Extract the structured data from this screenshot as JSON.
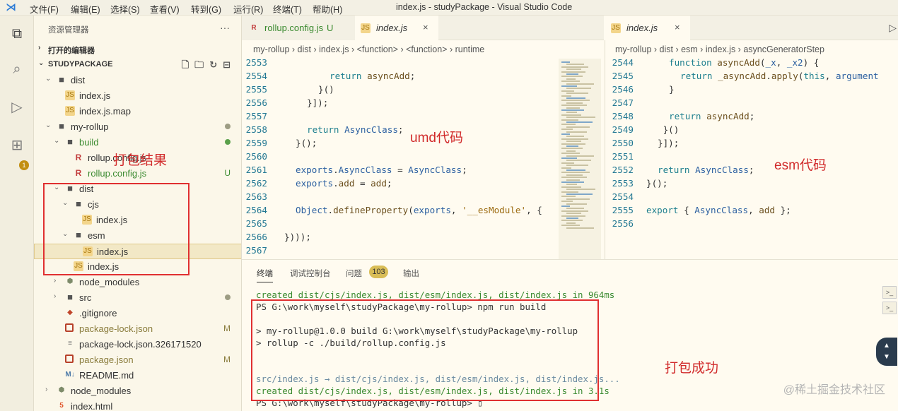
{
  "window": {
    "title": "index.js - studyPackage - Visual Studio Code",
    "menu": [
      "文件(F)",
      "编辑(E)",
      "选择(S)",
      "查看(V)",
      "转到(G)",
      "运行(R)",
      "终端(T)",
      "帮助(H)"
    ]
  },
  "activity_bar": {
    "icons": [
      "explorer-icon",
      "search-icon",
      "run-debug-icon",
      "extensions-icon"
    ],
    "badge": "1"
  },
  "sidebar": {
    "title": "资源管理器",
    "more": "···",
    "open_editors": "打开的编辑器",
    "workspace": "STUDYPACKAGE",
    "tree": [
      {
        "name": "dist",
        "type": "folder",
        "indent": 1
      },
      {
        "name": "index.js",
        "type": "js",
        "indent": 2
      },
      {
        "name": "index.js.map",
        "type": "js",
        "indent": 2
      },
      {
        "name": "my-rollup",
        "type": "folder",
        "indent": 1,
        "status": "dot"
      },
      {
        "name": "build",
        "type": "folder",
        "indent": 2,
        "status": "dot-green",
        "color": "green"
      },
      {
        "name": "rollup.config.js",
        "type": "rollup",
        "indent": 3
      },
      {
        "name": "rollup.config.js",
        "type": "rollup",
        "indent": 3,
        "status": "U",
        "color": "green"
      },
      {
        "name": "dist",
        "type": "folder",
        "indent": 2
      },
      {
        "name": "cjs",
        "type": "folder",
        "indent": 3
      },
      {
        "name": "index.js",
        "type": "js",
        "indent": 4
      },
      {
        "name": "esm",
        "type": "folder",
        "indent": 3
      },
      {
        "name": "index.js",
        "type": "js",
        "indent": 4,
        "selected": true
      },
      {
        "name": "index.js",
        "type": "js",
        "indent": 3
      },
      {
        "name": "node_modules",
        "type": "nm",
        "indent": 2
      },
      {
        "name": "src",
        "type": "folder",
        "indent": 2,
        "status": "dot"
      },
      {
        "name": ".gitignore",
        "type": "git",
        "indent": 2
      },
      {
        "name": "package-lock.json",
        "type": "json",
        "indent": 2,
        "status": "M",
        "color": "olive"
      },
      {
        "name": "package-lock.json.326171520",
        "type": "file",
        "indent": 2
      },
      {
        "name": "package.json",
        "type": "json",
        "indent": 2,
        "status": "M",
        "color": "olive"
      },
      {
        "name": "README.md",
        "type": "md",
        "indent": 2
      },
      {
        "name": "node_modules",
        "type": "nm",
        "indent": 1
      },
      {
        "name": "index.html",
        "type": "html",
        "indent": 1
      }
    ]
  },
  "editor_left": {
    "tabs": [
      {
        "label": "rollup.config.js",
        "status": "U",
        "icon": "rollup"
      },
      {
        "label": "index.js",
        "close": "×",
        "icon": "js"
      }
    ],
    "breadcrumb": [
      "my-rollup",
      "dist",
      "index.js",
      "<function>",
      "<function>",
      "runtime"
    ],
    "lines": [
      {
        "n": "2553",
        "indent": 3,
        "parts": [
          [
            "",
            ""
          ]
        ]
      },
      {
        "n": "2554",
        "indent": 4,
        "parts": [
          [
            "kw",
            "return "
          ],
          [
            "fn",
            "asyncAdd"
          ],
          [
            "tx-d",
            ";"
          ]
        ]
      },
      {
        "n": "2555",
        "indent": 3,
        "parts": [
          [
            "tx-d",
            "}()"
          ]
        ]
      },
      {
        "n": "2556",
        "indent": 2,
        "parts": [
          [
            "tx-d",
            "}]);"
          ]
        ]
      },
      {
        "n": "2557",
        "indent": 0,
        "parts": [
          [
            "",
            ""
          ]
        ]
      },
      {
        "n": "2558",
        "indent": 2,
        "parts": [
          [
            "kw",
            "return "
          ],
          [
            "id",
            "AsyncClass"
          ],
          [
            "tx-d",
            ";"
          ]
        ]
      },
      {
        "n": "2559",
        "indent": 1,
        "parts": [
          [
            "tx-d",
            "}();"
          ]
        ]
      },
      {
        "n": "2560",
        "indent": 0,
        "parts": [
          [
            "",
            ""
          ]
        ]
      },
      {
        "n": "2561",
        "indent": 1,
        "parts": [
          [
            "id",
            "exports"
          ],
          [
            "tx-d",
            "."
          ],
          [
            "id",
            "AsyncClass"
          ],
          [
            "tx-d",
            " = "
          ],
          [
            "id",
            "AsyncClass"
          ],
          [
            "tx-d",
            ";"
          ]
        ]
      },
      {
        "n": "2562",
        "indent": 1,
        "parts": [
          [
            "id",
            "exports"
          ],
          [
            "tx-d",
            "."
          ],
          [
            "fn",
            "add"
          ],
          [
            "tx-d",
            " = "
          ],
          [
            "fn",
            "add"
          ],
          [
            "tx-d",
            ";"
          ]
        ]
      },
      {
        "n": "2563",
        "indent": 0,
        "parts": [
          [
            "",
            ""
          ]
        ]
      },
      {
        "n": "2564",
        "indent": 1,
        "parts": [
          [
            "id",
            "Object"
          ],
          [
            "tx-d",
            "."
          ],
          [
            "fn",
            "defineProperty"
          ],
          [
            "tx-d",
            "("
          ],
          [
            "id",
            "exports"
          ],
          [
            "tx-d",
            ", "
          ],
          [
            "str",
            "'__esModule'"
          ],
          [
            "tx-d",
            ", {"
          ]
        ]
      },
      {
        "n": "2565",
        "indent": 0,
        "parts": [
          [
            "",
            ""
          ]
        ]
      },
      {
        "n": "2566",
        "indent": 0,
        "parts": [
          [
            "tx-d",
            "})));"
          ]
        ]
      },
      {
        "n": "2567",
        "indent": 0,
        "parts": [
          [
            "",
            ""
          ]
        ]
      }
    ],
    "annotation": "umd代码"
  },
  "editor_right": {
    "tabs": [
      {
        "label": "index.js",
        "close": "×",
        "icon": "js"
      }
    ],
    "breadcrumb": [
      "my-rollup",
      "dist",
      "esm",
      "index.js",
      "asyncGeneratorStep"
    ],
    "lines": [
      {
        "n": "2544",
        "indent": 2,
        "parts": [
          [
            "kw",
            "function "
          ],
          [
            "fn",
            "asyncAdd"
          ],
          [
            "tx-d",
            "("
          ],
          [
            "id",
            "_x"
          ],
          [
            "tx-d",
            ", "
          ],
          [
            "id",
            "_x2"
          ],
          [
            "tx-d",
            ") {"
          ]
        ]
      },
      {
        "n": "2545",
        "indent": 3,
        "parts": [
          [
            "kw",
            "return "
          ],
          [
            "fn",
            "_asyncAdd"
          ],
          [
            "tx-d",
            "."
          ],
          [
            "fn",
            "apply"
          ],
          [
            "tx-d",
            "("
          ],
          [
            "kw",
            "this"
          ],
          [
            "tx-d",
            ", "
          ],
          [
            "id",
            "argument"
          ]
        ]
      },
      {
        "n": "2546",
        "indent": 2,
        "parts": [
          [
            "tx-d",
            "}"
          ]
        ]
      },
      {
        "n": "2547",
        "indent": 0,
        "parts": [
          [
            "",
            ""
          ]
        ]
      },
      {
        "n": "2548",
        "indent": 2,
        "parts": [
          [
            "kw",
            "return "
          ],
          [
            "fn",
            "asyncAdd"
          ],
          [
            "tx-d",
            ";"
          ]
        ]
      },
      {
        "n": "2549",
        "indent": 1,
        "parts": [
          [
            "tx-d",
            " }()"
          ]
        ]
      },
      {
        "n": "2550",
        "indent": 1,
        "parts": [
          [
            "tx-d",
            "}]);"
          ]
        ]
      },
      {
        "n": "2551",
        "indent": 0,
        "parts": [
          [
            "",
            ""
          ]
        ]
      },
      {
        "n": "2552",
        "indent": 1,
        "parts": [
          [
            "kw",
            "return "
          ],
          [
            "id",
            "AsyncClass"
          ],
          [
            "tx-d",
            ";"
          ]
        ]
      },
      {
        "n": "2553",
        "indent": 0,
        "parts": [
          [
            "tx-d",
            "}();"
          ]
        ]
      },
      {
        "n": "2554",
        "indent": 0,
        "parts": [
          [
            "",
            ""
          ]
        ]
      },
      {
        "n": "2555",
        "indent": 0,
        "parts": [
          [
            "kw",
            "export "
          ],
          [
            "tx-d",
            "{ "
          ],
          [
            "id",
            "AsyncClass"
          ],
          [
            "tx-d",
            ", "
          ],
          [
            "fn",
            "add"
          ],
          [
            "tx-d",
            " };"
          ]
        ]
      },
      {
        "n": "2556",
        "indent": 0,
        "parts": [
          [
            "",
            ""
          ]
        ]
      }
    ],
    "annotation": "esm代码"
  },
  "sidebar_annotation": "打包结果",
  "panel": {
    "tabs": [
      "终端",
      "调试控制台",
      "问题",
      "输出"
    ],
    "problems_count": "103",
    "terminal": [
      {
        "cls": "t-green",
        "text": "created dist/cjs/index.js, dist/esm/index.js, dist/index.js in 964ms"
      },
      {
        "cls": "",
        "text": "PS G:\\work\\myself\\studyPackage\\my-rollup> npm run build"
      },
      {
        "cls": "",
        "text": ""
      },
      {
        "cls": "",
        "text": "> my-rollup@1.0.0 build G:\\work\\myself\\studyPackage\\my-rollup"
      },
      {
        "cls": "",
        "text": "> rollup -c ./build/rollup.config.js"
      },
      {
        "cls": "",
        "text": ""
      },
      {
        "cls": "",
        "text": ""
      },
      {
        "cls": "t-dim",
        "text": "src/index.js → dist/cjs/index.js, dist/esm/index.js, dist/index.js..."
      },
      {
        "cls": "t-green",
        "text": "created dist/cjs/index.js, dist/esm/index.js, dist/index.js in 3.1s"
      },
      {
        "cls": "",
        "text": "PS G:\\work\\myself\\studyPackage\\my-rollup> ▯"
      }
    ],
    "annotation": "打包成功"
  },
  "watermark": "@稀土掘金技术社区"
}
